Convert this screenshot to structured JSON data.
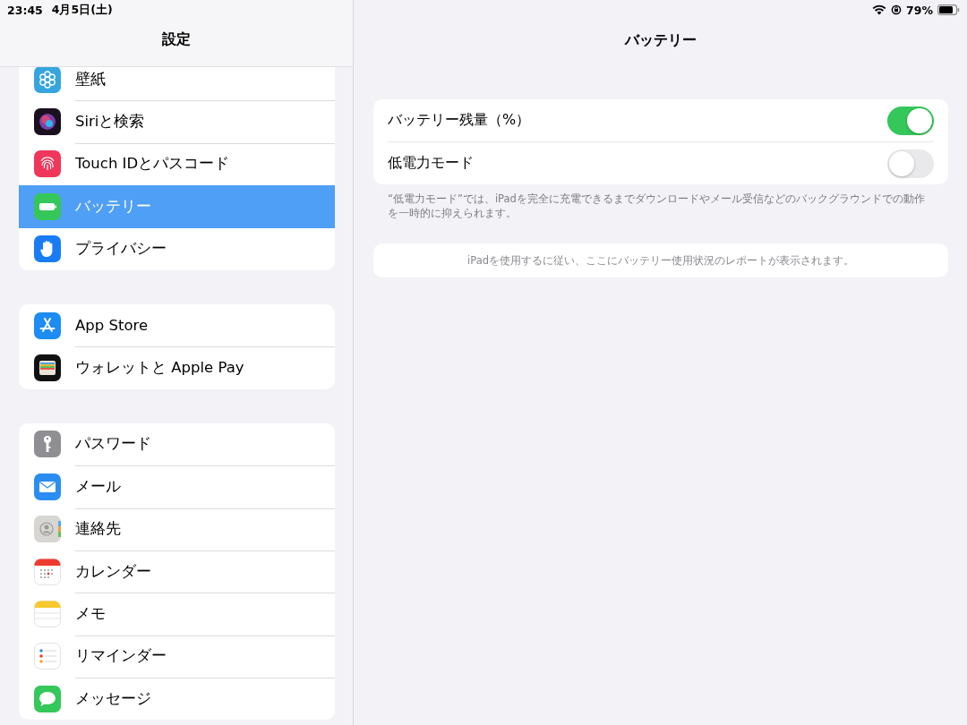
{
  "status_bar": {
    "time": "23:45",
    "date": "4月5日(土)",
    "battery_percent": "79%"
  },
  "sidebar": {
    "title": "設定",
    "groups": [
      {
        "items": [
          {
            "label": "壁紙",
            "kind": "wallpaper",
            "selected": false
          },
          {
            "label": "Siriと検索",
            "kind": "siri",
            "selected": false
          },
          {
            "label": "Touch IDとパスコード",
            "kind": "fingerprint",
            "selected": false
          },
          {
            "label": "バッテリー",
            "kind": "battery",
            "selected": true
          },
          {
            "label": "プライバシー",
            "kind": "hand",
            "selected": false
          }
        ]
      },
      {
        "items": [
          {
            "label": "App Store",
            "kind": "appstore",
            "selected": false
          },
          {
            "label": "ウォレットと Apple Pay",
            "kind": "wallet",
            "selected": false
          }
        ]
      },
      {
        "items": [
          {
            "label": "パスワード",
            "kind": "key",
            "selected": false
          },
          {
            "label": "メール",
            "kind": "mail",
            "selected": false
          },
          {
            "label": "連絡先",
            "kind": "contacts",
            "selected": false
          },
          {
            "label": "カレンダー",
            "kind": "calendar",
            "selected": false
          },
          {
            "label": "メモ",
            "kind": "notes",
            "selected": false
          },
          {
            "label": "リマインダー",
            "kind": "reminders",
            "selected": false
          },
          {
            "label": "メッセージ",
            "kind": "messages",
            "selected": false
          }
        ]
      }
    ]
  },
  "detail": {
    "title": "バッテリー",
    "toggles": [
      {
        "label": "バッテリー残量（%）",
        "on": true
      },
      {
        "label": "低電力モード",
        "on": false
      }
    ],
    "footnote": "“低電力モード”では、iPadを完全に充電できるまでダウンロードやメール受信などのバックグラウンドでの動作を一時的に抑えられます。",
    "report_note": "iPadを使用するに従い、ここにバッテリー使用状況のレポートが表示されます。"
  }
}
